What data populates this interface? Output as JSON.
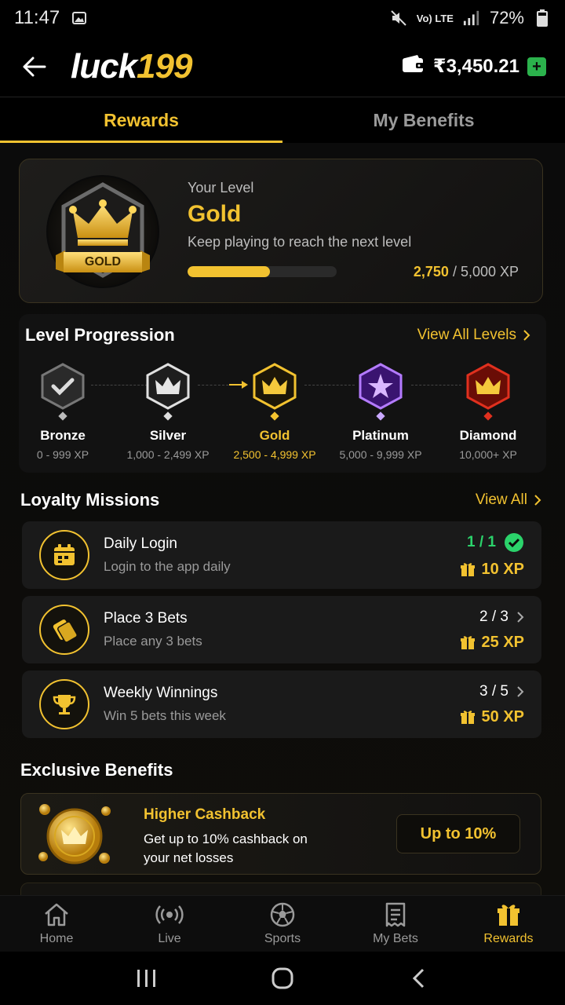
{
  "status_bar": {
    "time": "11:47",
    "network": "Vo) LTE",
    "battery": "72%"
  },
  "header": {
    "logo_part1": "luck",
    "logo_part2": "199",
    "wallet_amount": "₹3,450.21",
    "add_label": "+"
  },
  "tabs": [
    {
      "label": "Rewards",
      "active": true
    },
    {
      "label": "My Benefits",
      "active": false
    }
  ],
  "level_card": {
    "badge_label": "GOLD",
    "your_level_label": "Your Level",
    "level_name": "Gold",
    "subtitle": "Keep playing to reach the next level",
    "xp_current": "2,750",
    "xp_total": "/ 5,000 XP",
    "progress_fraction": 0.55
  },
  "level_progression": {
    "title": "Level Progression",
    "view_all": "View All Levels",
    "tiers": [
      {
        "name": "Bronze",
        "range": "0 - 999 XP",
        "color": "#6f6f6f"
      },
      {
        "name": "Silver",
        "range": "1,000 - 2,499 XP",
        "color": "#cfcfcf"
      },
      {
        "name": "Gold",
        "range": "2,500 - 4,999 XP",
        "color": "#f2c230"
      },
      {
        "name": "Platinum",
        "range": "5,000 - 9,999 XP",
        "color": "#9b4dff"
      },
      {
        "name": "Diamond",
        "range": "10,000+ XP",
        "color": "#e0301e"
      }
    ]
  },
  "missions": {
    "title": "Loyalty Missions",
    "view_all": "View All",
    "items": [
      {
        "title": "Daily Login",
        "desc": "Login to the app daily",
        "progress": "1 / 1",
        "reward": "10 XP",
        "icon": "calendar-icon",
        "done": true
      },
      {
        "title": "Place 3 Bets",
        "desc": "Place any 3 bets",
        "progress": "2 / 3",
        "reward": "25 XP",
        "icon": "tickets-icon",
        "done": false
      },
      {
        "title": "Weekly Winnings",
        "desc": "Win 5 bets this week",
        "progress": "3 / 5",
        "reward": "50 XP",
        "icon": "trophy-icon",
        "done": false
      }
    ]
  },
  "benefits": {
    "title": "Exclusive Benefits",
    "items": [
      {
        "title": "Higher Cashback",
        "desc": "Get up to 10% cashback on your net losses",
        "button": "Up to 10%"
      }
    ]
  },
  "bottom_nav": [
    {
      "label": "Home",
      "icon": "home-icon"
    },
    {
      "label": "Live",
      "icon": "live-icon"
    },
    {
      "label": "Sports",
      "icon": "soccer-ball-icon"
    },
    {
      "label": "My Bets",
      "icon": "bet-slip-icon"
    },
    {
      "label": "Rewards",
      "icon": "gift-icon",
      "active": true
    }
  ],
  "colors": {
    "accent": "#f2c230",
    "success": "#2bd36b",
    "background": "#000000"
  }
}
